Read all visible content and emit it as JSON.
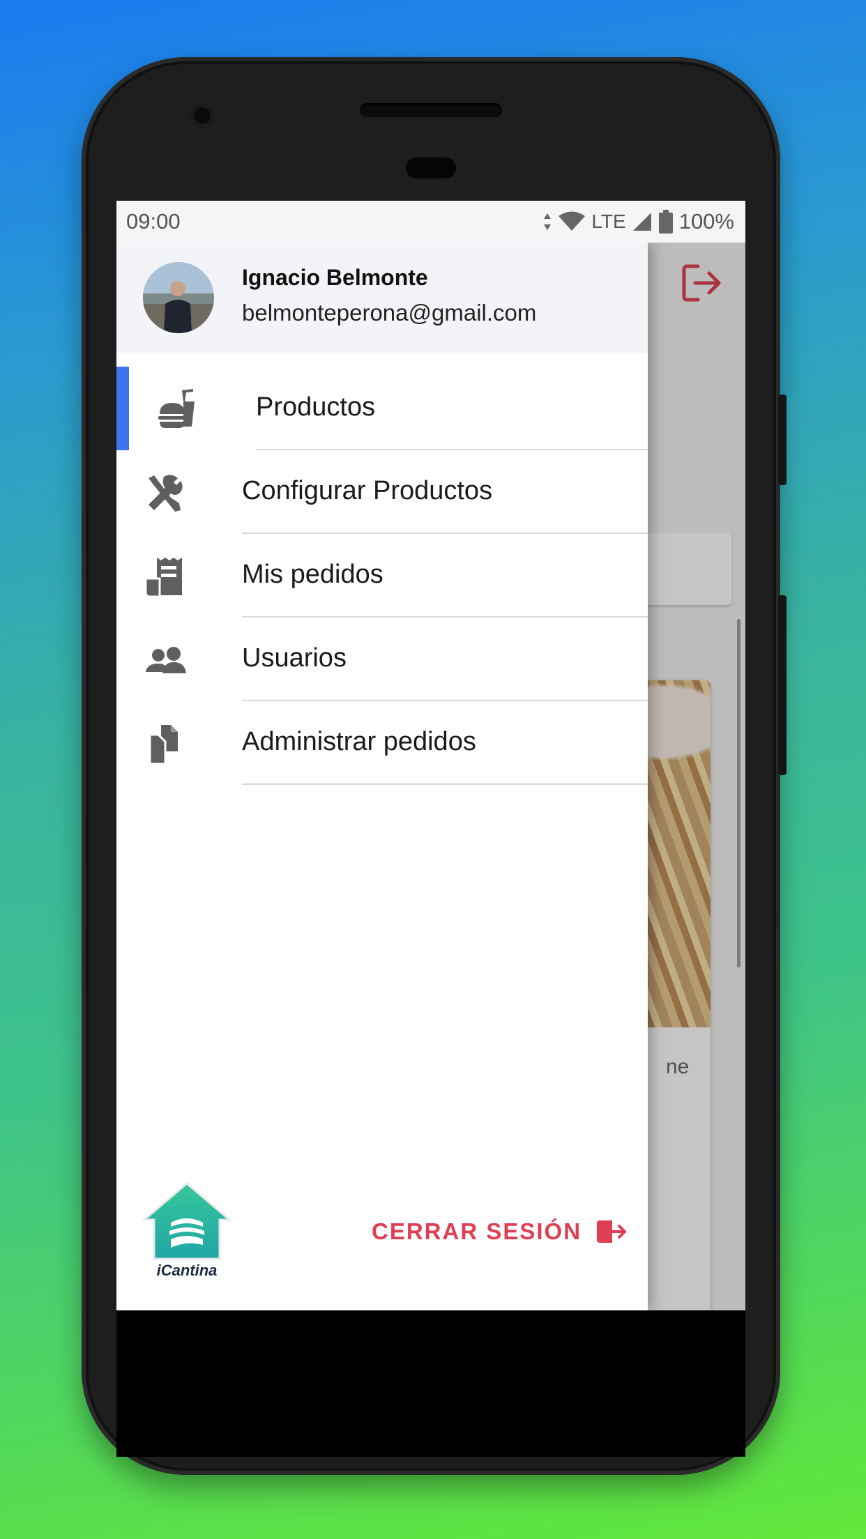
{
  "status_bar": {
    "time": "09:00",
    "network": "LTE",
    "battery": "100%"
  },
  "drawer": {
    "user": {
      "name": "Ignacio Belmonte",
      "email": "belmonteperona@gmail.com"
    },
    "menu": [
      {
        "label": "Productos",
        "icon": "burger-drink-icon",
        "active": true
      },
      {
        "label": "Configurar Productos",
        "icon": "tools-icon",
        "active": false
      },
      {
        "label": "Mis pedidos",
        "icon": "receipt-icon",
        "active": false
      },
      {
        "label": "Usuarios",
        "icon": "users-icon",
        "active": false
      },
      {
        "label": "Administrar pedidos",
        "icon": "copy-documents-icon",
        "active": false
      }
    ],
    "logo_text": "iCantina",
    "logout_label": "CERRAR SESIÓN"
  },
  "background": {
    "card_text_fragment": "ne"
  },
  "colors": {
    "accent": "#3f73f0",
    "logout": "#e03e52",
    "icon": "#5f5f5f",
    "logo_green": "#3cc29a"
  }
}
